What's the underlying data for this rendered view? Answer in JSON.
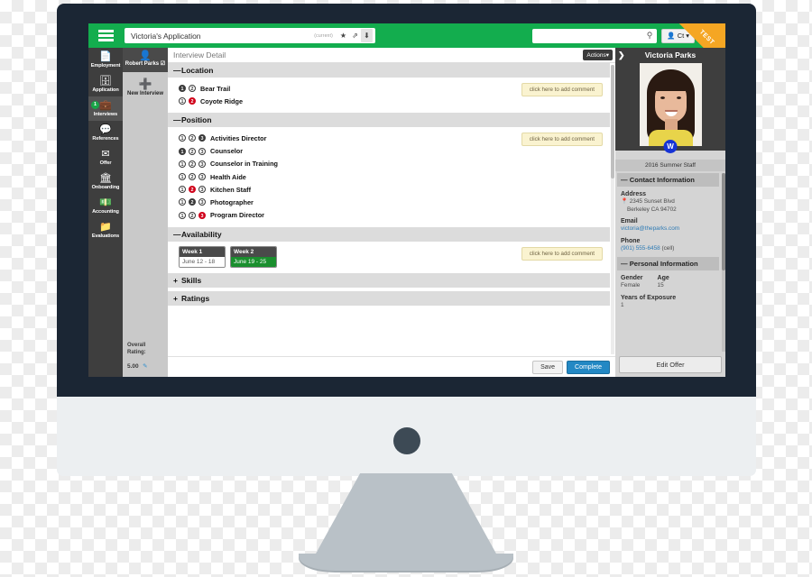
{
  "browser": {
    "menu_icon": "hamburger-icon",
    "address_title": "Victoria's Application",
    "address_current": "(current)",
    "icon_star": "★",
    "icon_external": "⇗",
    "icon_download": "⬇",
    "search_placeholder": "",
    "search_icon": "search-icon",
    "user_button": "Ct",
    "user_icon": "user-icon",
    "caret": "▾",
    "ribbon_label": "TEST"
  },
  "sidebar": {
    "items": [
      {
        "label": "Employment",
        "icon": "document-icon",
        "badge": null,
        "active": false
      },
      {
        "label": "Application",
        "icon": "archive-icon",
        "badge": null,
        "active": false
      },
      {
        "label": "Interviews",
        "icon": "briefcase-icon",
        "badge": "1",
        "active": true
      },
      {
        "label": "References",
        "icon": "chat-icon",
        "badge": null,
        "active": false
      },
      {
        "label": "Offer",
        "icon": "envelope-icon",
        "badge": null,
        "active": false
      },
      {
        "label": "Onboarding",
        "icon": "bank-icon",
        "badge": null,
        "active": false
      },
      {
        "label": "Accounting",
        "icon": "money-icon",
        "badge": null,
        "active": false
      },
      {
        "label": "Evaluations",
        "icon": "folder-icon",
        "badge": null,
        "active": false
      }
    ]
  },
  "sidebar2": {
    "header_name": "Robert Parks ☑",
    "header_icon": "user-icon",
    "new_interview_label": "New Interview",
    "new_interview_icon": "plus-circle-icon",
    "overall_rating_label": "Overall Rating:",
    "overall_rating_value": "5.00",
    "edit_icon": "pencil-icon"
  },
  "main": {
    "title": "Interview Detail",
    "actions_label": "Actions",
    "actions_caret": "▾",
    "comment_button_label": "click here to add comment",
    "sections": [
      {
        "name": "Location",
        "collapsed": false,
        "symbol": "—",
        "rows": [
          {
            "label": "Bear Trail",
            "dots": [
              {
                "n": "1",
                "state": "dark"
              },
              {
                "n": "2",
                "state": "empty"
              }
            ]
          },
          {
            "label": "Coyote Ridge",
            "dots": [
              {
                "n": "1",
                "state": "empty"
              },
              {
                "n": "2",
                "state": "red"
              }
            ]
          }
        ]
      },
      {
        "name": "Position",
        "collapsed": false,
        "symbol": "—",
        "rows": [
          {
            "label": "Activities Director",
            "dots": [
              {
                "n": "1",
                "state": "empty"
              },
              {
                "n": "2",
                "state": "empty"
              },
              {
                "n": "3",
                "state": "dark"
              }
            ]
          },
          {
            "label": "Counselor",
            "dots": [
              {
                "n": "1",
                "state": "dark"
              },
              {
                "n": "2",
                "state": "empty"
              },
              {
                "n": "3",
                "state": "empty"
              }
            ]
          },
          {
            "label": "Counselor in Training",
            "dots": [
              {
                "n": "1",
                "state": "empty"
              },
              {
                "n": "2",
                "state": "empty"
              },
              {
                "n": "3",
                "state": "empty"
              }
            ]
          },
          {
            "label": "Health Aide",
            "dots": [
              {
                "n": "1",
                "state": "empty"
              },
              {
                "n": "2",
                "state": "empty"
              },
              {
                "n": "3",
                "state": "empty"
              }
            ]
          },
          {
            "label": "Kitchen Staff",
            "dots": [
              {
                "n": "1",
                "state": "empty"
              },
              {
                "n": "2",
                "state": "red"
              },
              {
                "n": "3",
                "state": "empty"
              }
            ]
          },
          {
            "label": "Photographer",
            "dots": [
              {
                "n": "1",
                "state": "empty"
              },
              {
                "n": "2",
                "state": "dark"
              },
              {
                "n": "3",
                "state": "empty"
              }
            ]
          },
          {
            "label": "Program Director",
            "dots": [
              {
                "n": "1",
                "state": "empty"
              },
              {
                "n": "2",
                "state": "empty"
              },
              {
                "n": "3",
                "state": "red"
              }
            ]
          }
        ]
      }
    ],
    "availability": {
      "name": "Availability",
      "symbol": "—",
      "weeks": [
        {
          "name": "Week 1",
          "dates": "June 12 - 18",
          "selected": false
        },
        {
          "name": "Week 2",
          "dates": "June 19 - 25",
          "selected": true
        }
      ]
    },
    "collapsed_sections": [
      {
        "name": "Skills",
        "symbol": "+"
      },
      {
        "name": "Ratings",
        "symbol": "+"
      }
    ],
    "footer": {
      "save_label": "Save",
      "complete_label": "Complete"
    }
  },
  "right_panel": {
    "arrow_icon": "chevron-right-icon",
    "name": "Victoria Parks",
    "avatar": "applicant-photo",
    "badge_letter": "W",
    "role": "2016 Summer Staff",
    "contact_header": "Contact Information",
    "contact_symbol": "—",
    "address_label": "Address",
    "address_pin_icon": "map-pin-icon",
    "address_line1": "2345 Sunset Blvd",
    "address_line2": "Berkeley CA 94702",
    "email_label": "Email",
    "email_value": "victoria@theparks.com",
    "phone_label": "Phone",
    "phone_value": "(901) 555-6458",
    "phone_type": "(cell)",
    "personal_header": "Personal Information",
    "personal_symbol": "—",
    "gender_label": "Gender",
    "gender_value": "Female",
    "age_label": "Age",
    "age_value": "15",
    "exposure_label": "Years of Exposure",
    "exposure_value": "1",
    "edit_offer_label": "Edit Offer"
  },
  "colors": {
    "brand_green": "#13ad4e",
    "accent_blue": "#2388c4",
    "danger_red": "#d0021b",
    "ribbon_orange": "#f5a623",
    "bezel": "#1b2634"
  }
}
